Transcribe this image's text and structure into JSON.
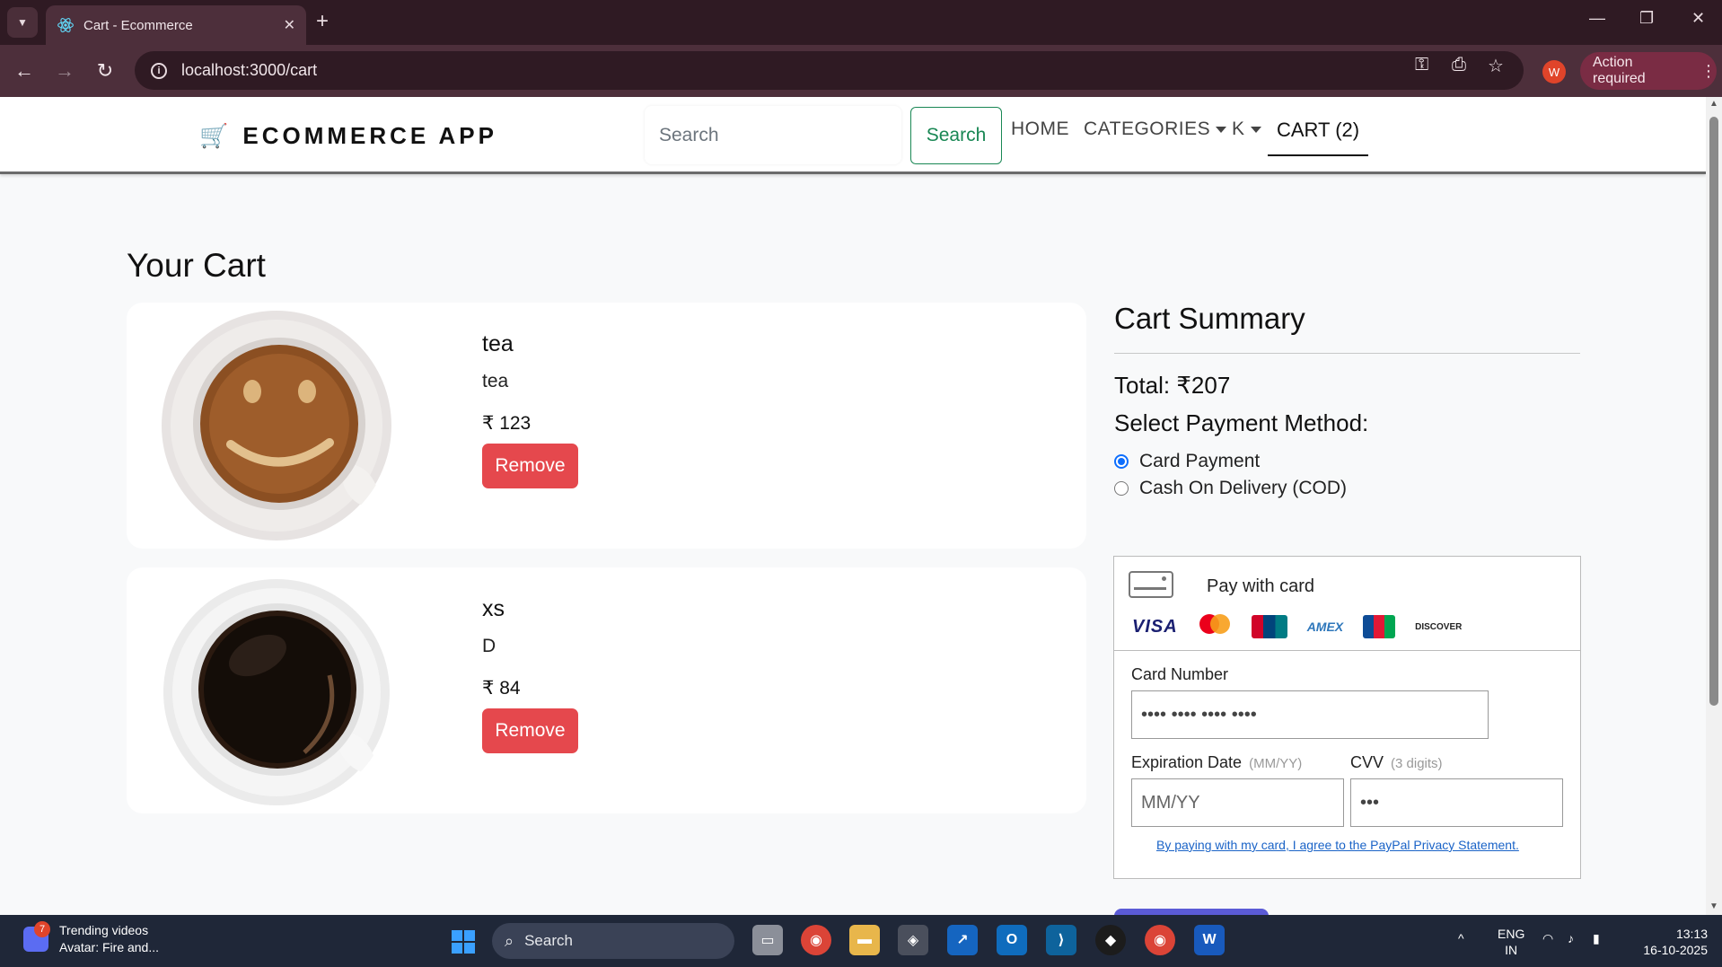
{
  "browser": {
    "tab_title": "Cart - Ecommerce",
    "url": "localhost:3000/cart",
    "profile_initial": "W",
    "action_required": "Action required"
  },
  "navbar": {
    "brand": "ECOMMERCE APP",
    "search_placeholder": "Search",
    "search_button": "Search",
    "links": {
      "home": "HOME",
      "categories": "CATEGORIES",
      "user": "K",
      "cart": "CART (2)"
    }
  },
  "page": {
    "title": "Your Cart"
  },
  "cart_items": [
    {
      "name": "tea",
      "description": "tea",
      "price": "₹ 123",
      "remove_label": "Remove",
      "image": "latte-coffee-cup"
    },
    {
      "name": "xs",
      "description": "D",
      "price": "₹ 84",
      "remove_label": "Remove",
      "image": "black-coffee-cup"
    }
  ],
  "summary": {
    "title": "Cart Summary",
    "total": "Total: ₹207",
    "payment_heading": "Select Payment Method:",
    "options": [
      {
        "label": "Card Payment",
        "checked": true
      },
      {
        "label": "Cash On Delivery (COD)",
        "checked": false
      }
    ]
  },
  "card_form": {
    "heading": "Pay with card",
    "brands": [
      "VISA",
      "mastercard",
      "UnionPay",
      "AMEX",
      "JCB",
      "DISCOVER"
    ],
    "card_number_label": "Card Number",
    "card_number_value": "•••• •••• •••• ••••",
    "expiry_label": "Expiration Date",
    "expiry_hint": "(MM/YY)",
    "expiry_placeholder": "MM/YY",
    "cvv_label": "CVV",
    "cvv_hint": "(3 digits)",
    "cvv_value": "•••",
    "privacy_text": "By paying with my card, I agree to the PayPal Privacy Statement."
  },
  "taskbar": {
    "widget_badge": "7",
    "widget_title": "Trending videos",
    "widget_subtitle": "Avatar: Fire and...",
    "search": "Search",
    "lang_top": "ENG",
    "lang_bottom": "IN",
    "time": "13:13",
    "date": "16-10-2025"
  },
  "colors": {
    "remove_button": "#e5484d",
    "search_button": "#198754",
    "radio_checked": "#0d6efd",
    "browser_frame": "#4d2f3b"
  }
}
